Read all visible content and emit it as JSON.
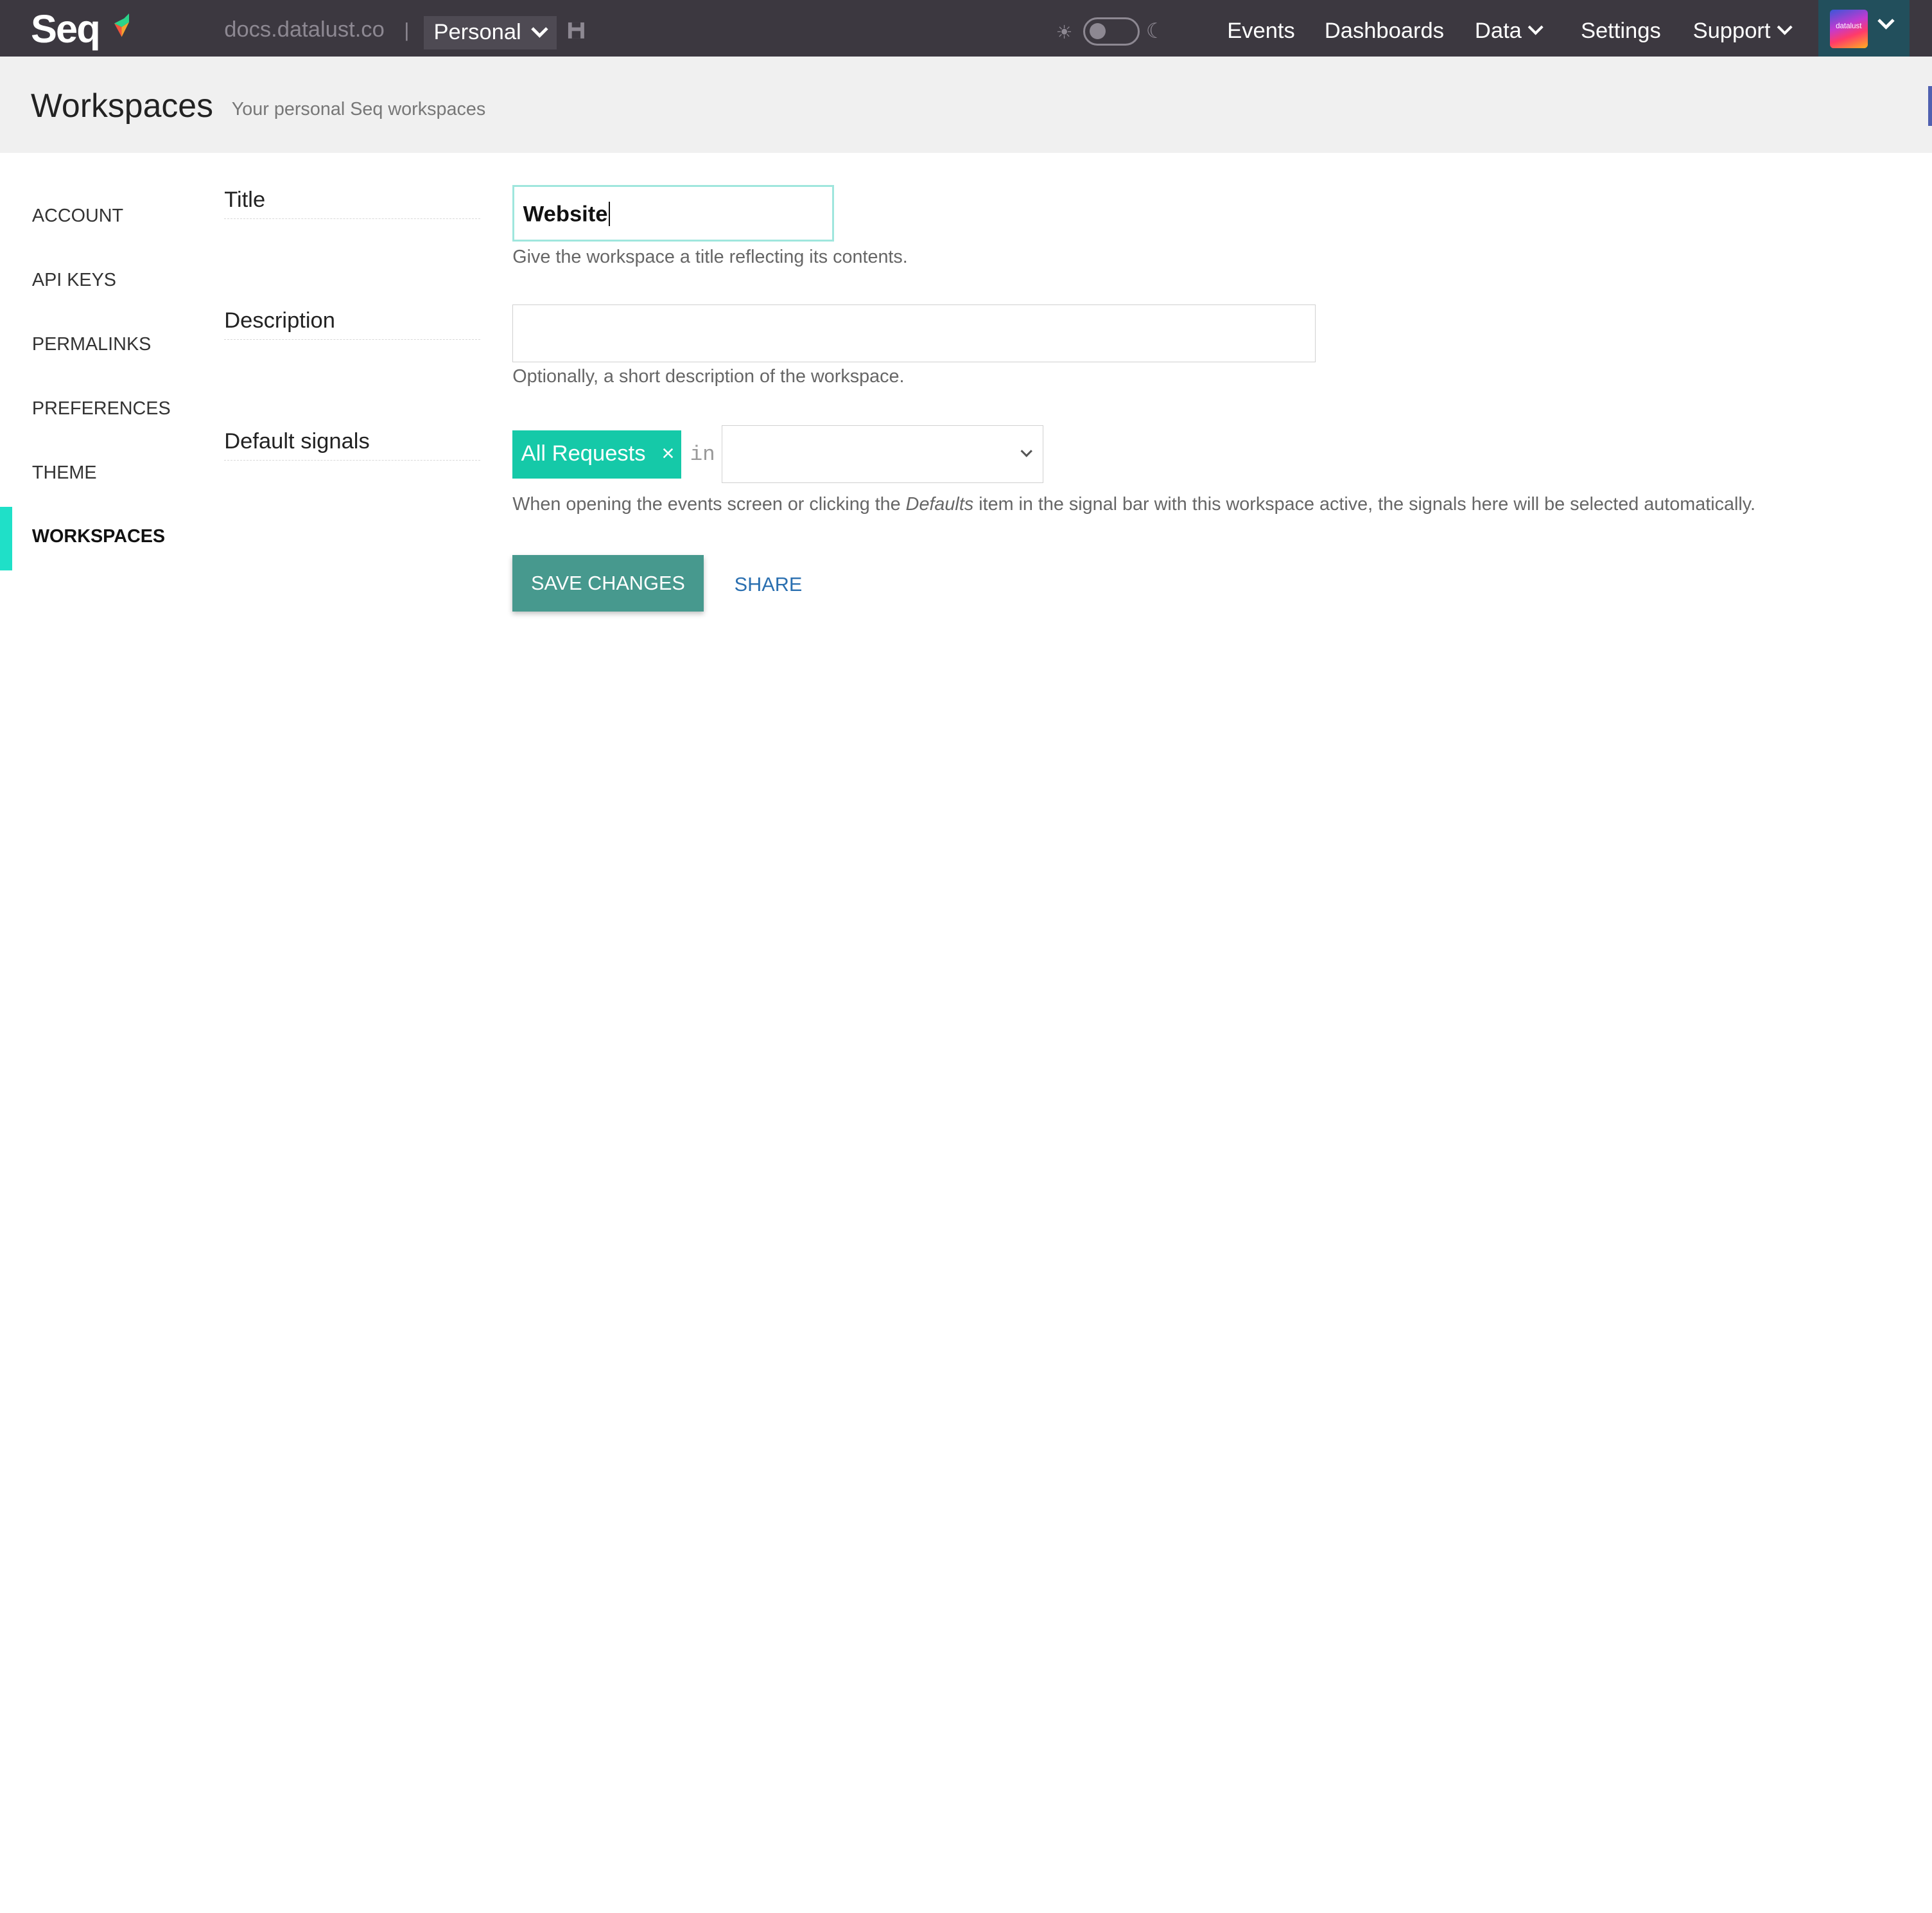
{
  "topbar": {
    "logo": "Seq",
    "server": "docs.datalust.co",
    "separator": "|",
    "workspace": "Personal",
    "avatar_text": "datalust",
    "nav": [
      "Events",
      "Dashboards",
      "Data",
      "Settings",
      "Support"
    ],
    "icons": [
      "logo-mark-icon",
      "chevron-down-icon",
      "save-icon",
      "sun-icon",
      "moon-icon"
    ]
  },
  "header": {
    "title": "Workspaces",
    "subtitle": "Your personal Seq workspaces"
  },
  "sidebar": {
    "items": [
      "ACCOUNT",
      "API KEYS",
      "PERMALINKS",
      "PREFERENCES",
      "THEME",
      "WORKSPACES"
    ],
    "active": "WORKSPACES"
  },
  "form": {
    "title_label": "Title",
    "title_value": "Website",
    "title_help": "Give the workspace a title reflecting its contents.",
    "description_label": "Description",
    "description_value": "",
    "description_help": "Optionally, a short description of the workspace.",
    "signals_label": "Default signals",
    "signal_chip": "All Requests",
    "signal_remove": "×",
    "in_label": "in",
    "signals_help_before": "When opening the events screen or clicking the ",
    "signals_help_emph": "Defaults",
    "signals_help_after": " item in the signal bar with this workspace active, the signals here will be selected automatically."
  },
  "actions": {
    "save": "SAVE CHANGES",
    "share": "SHARE"
  },
  "colors": {
    "topbar": "#3c3840",
    "accent": "#15c9a8",
    "save_button": "#47998e",
    "link": "#2a6fb0"
  }
}
